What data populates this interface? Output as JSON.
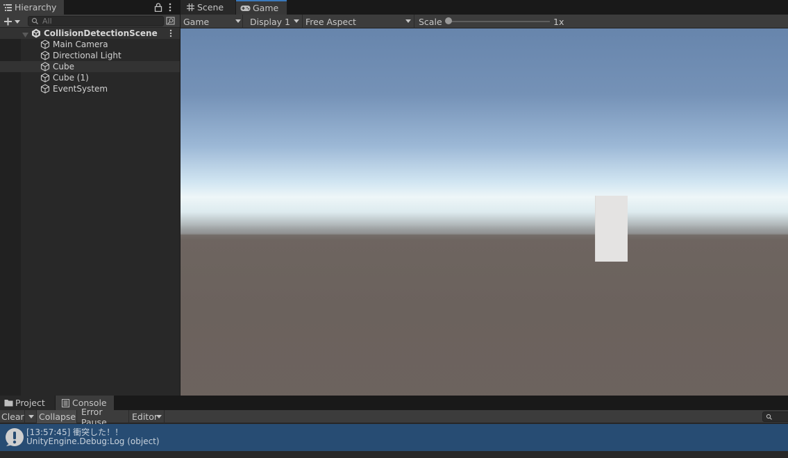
{
  "hierarchy": {
    "tab_label": "Hierarchy",
    "search_placeholder": "All",
    "scene_name": "CollisionDetectionScene",
    "items": [
      {
        "label": "Main Camera"
      },
      {
        "label": "Directional Light"
      },
      {
        "label": "Cube",
        "selected": true
      },
      {
        "label": "Cube (1)"
      },
      {
        "label": "EventSystem"
      }
    ]
  },
  "game_view": {
    "tabs": [
      {
        "label": "Scene",
        "icon": "grid-icon"
      },
      {
        "label": "Game",
        "icon": "gamepad-icon"
      }
    ],
    "active_tab": "Game",
    "view_dropdown": "Game",
    "display_dropdown": "Display 1",
    "aspect_dropdown": "Free Aspect",
    "scale_label": "Scale",
    "scale_value": "1x"
  },
  "console": {
    "tabs": [
      {
        "label": "Project",
        "icon": "folder-icon"
      },
      {
        "label": "Console",
        "icon": "console-icon"
      }
    ],
    "active_tab": "Console",
    "toolbar": {
      "clear": "Clear",
      "collapse": "Collapse",
      "error_pause": "Error Pause",
      "editor": "Editor"
    },
    "log": {
      "message": "[13:57:45] 衝突した！！",
      "detail": "UnityEngine.Debug:Log (object)"
    }
  },
  "colors": {
    "accent": "#3a79bb",
    "log_selected_bg": "#274c73",
    "panel_bg": "#282828",
    "toolbar_bg": "#3c3c3c"
  }
}
